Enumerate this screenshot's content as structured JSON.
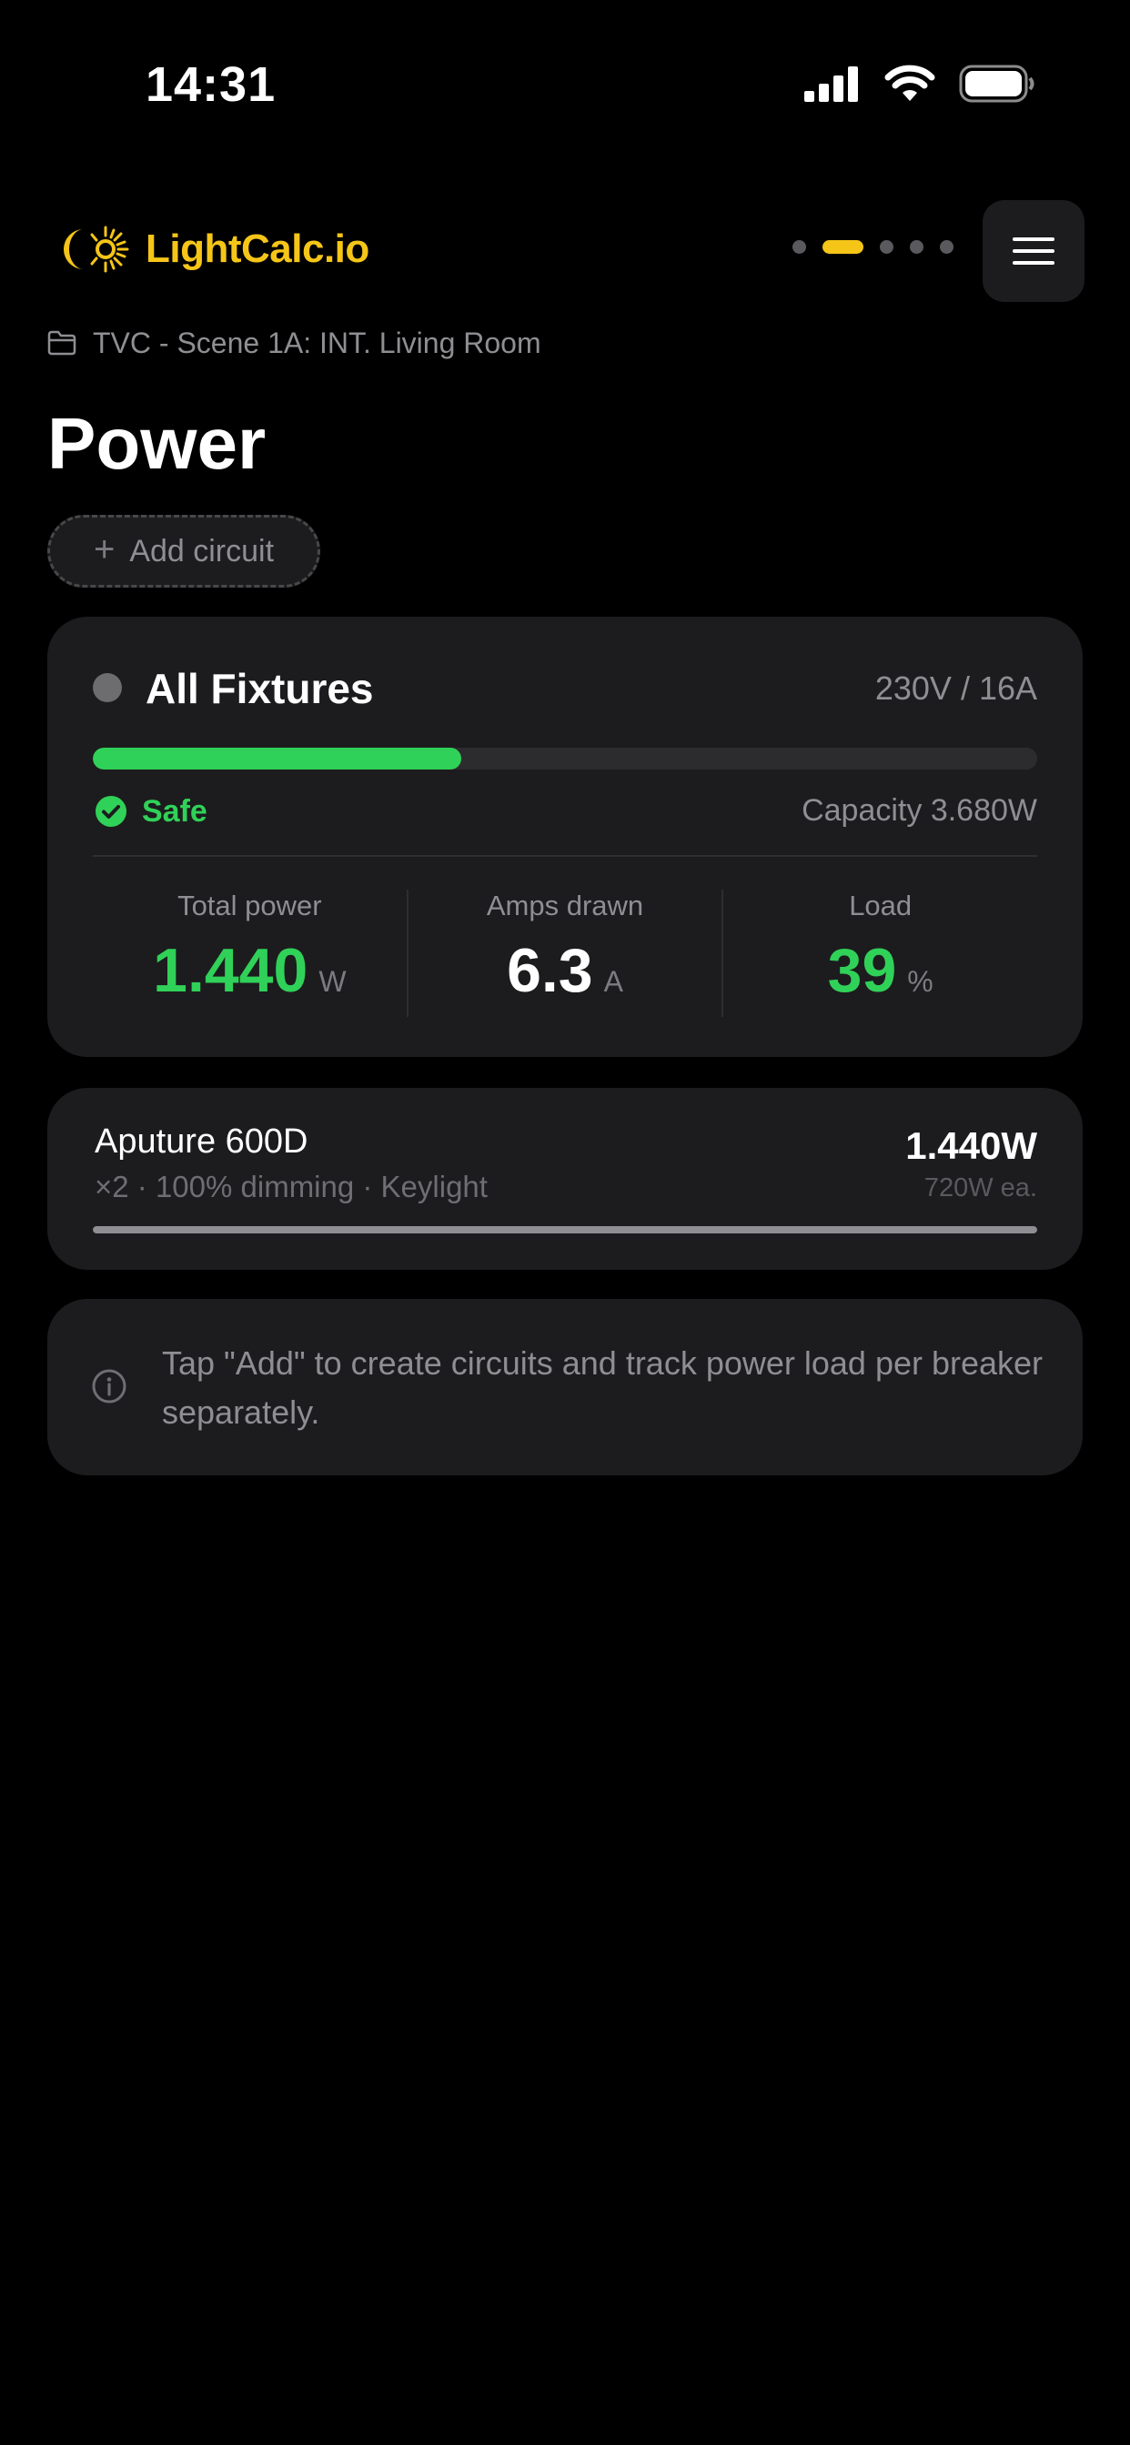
{
  "status_bar": {
    "time": "14:31",
    "icons": [
      "signal-icon",
      "wifi-icon",
      "battery-icon"
    ]
  },
  "header": {
    "logo_text": "LightCalc.io",
    "pager": {
      "count": 5,
      "active_index": 1
    },
    "menu_icon": "hamburger-menu-icon"
  },
  "breadcrumb": {
    "icon": "folder-icon",
    "text": "TVC - Scene 1A: INT. Living Room"
  },
  "page_title": "Power",
  "add_button": {
    "icon": "plus-icon",
    "label": "Add circuit"
  },
  "circuit": {
    "title": "All Fixtures",
    "spec": "230V / 16A",
    "load_fraction": 0.39,
    "status": "Safe",
    "capacity": "Capacity 3.680W",
    "stats": [
      {
        "label": "Total power",
        "value": "1.440",
        "unit": "W",
        "color": "#30d158"
      },
      {
        "label": "Amps drawn",
        "value": "6.3",
        "unit": "A",
        "color": "#ffffff"
      },
      {
        "label": "Load",
        "value": "39",
        "unit": "%",
        "color": "#30d158"
      }
    ]
  },
  "fixture": {
    "name": "Aputure 600D",
    "detail": "×2 · 100% dimming · Keylight",
    "watts": "1.440W",
    "each": "720W ea.",
    "share_fraction": 1.0
  },
  "info": {
    "icon": "info-icon",
    "text": "Tap \"Add\" to create circuits and track power load per breaker separately."
  },
  "colors": {
    "accent": "#f5c518",
    "safe": "#30d158",
    "card": "#1c1c1e",
    "background": "#000000"
  }
}
